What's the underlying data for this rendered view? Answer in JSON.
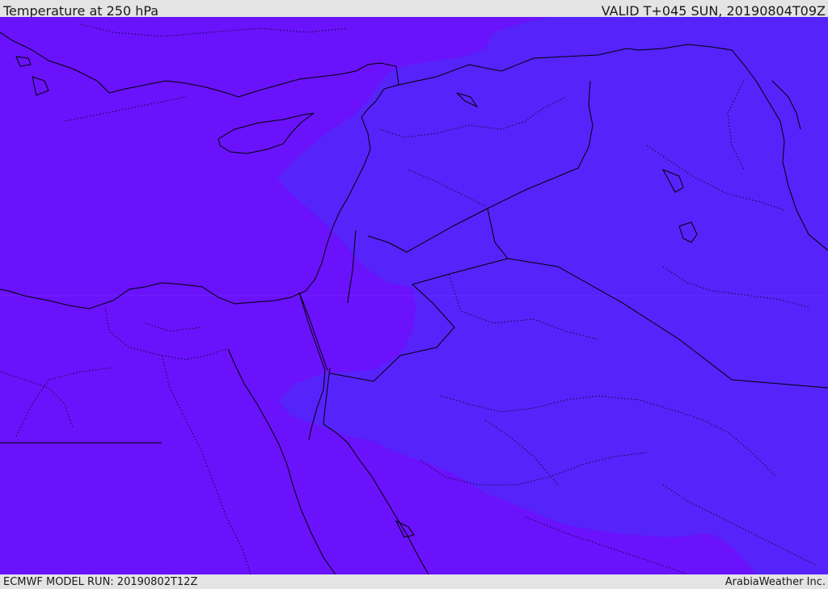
{
  "header": {
    "title": "Temperature at 250 hPa",
    "valid_time": "VALID T+045 SUN, 20190804T09Z"
  },
  "footer": {
    "model_run": "ECMWF MODEL RUN: 20190802T12Z",
    "credit": "ArabiaWeather Inc."
  },
  "map": {
    "variable": "Temperature at 250 hPa",
    "colors": {
      "field_warm": "#6a12fb",
      "field_cool": "#5623fb",
      "coastline": "#000000",
      "border": "#000000",
      "frame": "#e4e4e4"
    }
  }
}
